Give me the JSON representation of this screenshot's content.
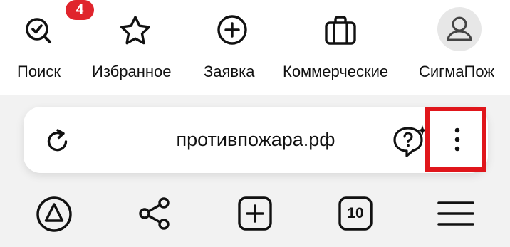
{
  "top_nav": {
    "items": [
      {
        "label": "Поиск",
        "icon": "search-check-icon",
        "badge": "4"
      },
      {
        "label": "Избранное",
        "icon": "star-icon"
      },
      {
        "label": "Заявка",
        "icon": "plus-circle-icon"
      },
      {
        "label": "Коммерческие",
        "icon": "briefcase-icon"
      },
      {
        "label": "СигмаПож",
        "icon": "user-avatar-icon"
      }
    ]
  },
  "address_bar": {
    "url": "противпожара.рф",
    "left_icon": "reload-icon",
    "ai_icon": "chat-sparkle-icon",
    "menu_icon": "kebab-menu-icon"
  },
  "highlight": {
    "color": "#e0161b",
    "target": "kebab-menu-button"
  },
  "bottom_toolbar": {
    "items": [
      {
        "icon": "alice-assistant-icon"
      },
      {
        "icon": "share-icon"
      },
      {
        "icon": "new-tab-icon"
      },
      {
        "icon": "tabs-icon",
        "count": "10"
      },
      {
        "icon": "hamburger-menu-icon"
      }
    ]
  },
  "colors": {
    "badge": "#e0242c",
    "background": "#f2f2f2",
    "surface": "#ffffff"
  }
}
